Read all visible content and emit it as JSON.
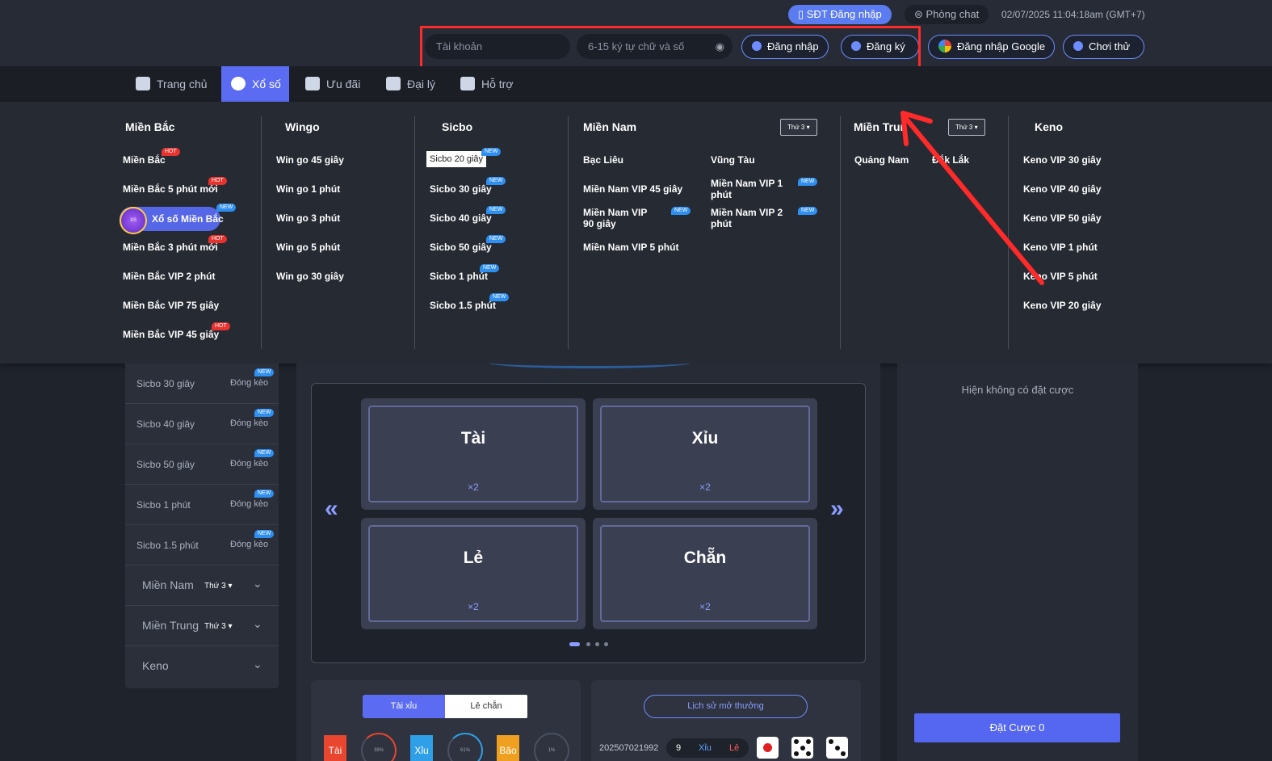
{
  "header": {
    "sdt_login": "SĐT Đăng nhập",
    "chat": "Phòng chat",
    "datetime": "02/07/2025 11:04:18am",
    "timezone": "(GMT+7)",
    "username_placeholder": "Tài khoản",
    "password_placeholder": "6-15 ký tự chữ và số",
    "login": "Đăng nhập",
    "register": "Đăng ký",
    "google_login": "Đăng nhập Google",
    "try": "Chơi thử"
  },
  "nav": [
    "Trang chủ",
    "Xổ số",
    "Ưu đãi",
    "Đại lý",
    "Hỗ trợ"
  ],
  "mega": {
    "mien_bac": {
      "title": "Miền Bắc",
      "items": [
        {
          "label": "Miền Bắc",
          "badge": "HOT"
        },
        {
          "label": "Miền Bắc 5 phút mới",
          "badge": "HOT"
        },
        {
          "label": "Xổ số Miền Bắc",
          "badge": "NEW"
        },
        {
          "label": "Miền Bắc 3 phút mới",
          "badge": "HOT"
        },
        {
          "label": "Miền Bắc VIP 2 phút",
          "badge": ""
        },
        {
          "label": "Miền Bắc VIP 75 giây",
          "badge": ""
        },
        {
          "label": "Miền Bắc VIP 45 giây",
          "badge": "HOT"
        }
      ]
    },
    "wingo": {
      "title": "Wingo",
      "items": [
        "Win go 45 giây",
        "Win go 1 phút",
        "Win go 3 phút",
        "Win go 5 phút",
        "Win go 30 giây"
      ]
    },
    "sicbo": {
      "title": "Sicbo",
      "items": [
        "Sicbo 20 giây",
        "Sicbo 30 giây",
        "Sicbo 40 giây",
        "Sicbo 50 giây",
        "Sicbo 1 phút",
        "Sicbo 1.5 phút"
      ],
      "badge": "NEW"
    },
    "mien_nam": {
      "title": "Miền Nam",
      "day": "Thứ 3",
      "items": [
        "Bạc Liêu",
        "Vũng Tàu",
        "Miền Nam VIP 45 giây",
        "Miền Nam VIP 1 phút",
        "Miền Nam VIP 90 giây",
        "Miền Nam VIP 2 phút",
        "Miền Nam VIP 5 phút"
      ],
      "badge": "NEW"
    },
    "mien_trung": {
      "title": "Miền Trun",
      "day": "Thứ 3",
      "items": [
        "Quảng Nam",
        "Đắk Lắk"
      ]
    },
    "keno": {
      "title": "Keno",
      "items": [
        "Keno VIP 30 giây",
        "Keno VIP 40 giây",
        "Keno VIP 50 giây",
        "Keno VIP 1 phút",
        "Keno VIP 5 phút",
        "Keno VIP 20 giây"
      ]
    }
  },
  "sidebar": {
    "rows": [
      {
        "name": "Sicbo 30 giây",
        "status": "Đóng kèo",
        "badge": "NEW"
      },
      {
        "name": "Sicbo 40 giây",
        "status": "Đóng kèo",
        "badge": "NEW"
      },
      {
        "name": "Sicbo 50 giây",
        "status": "Đóng kèo",
        "badge": "NEW"
      },
      {
        "name": "Sicbo 1 phút",
        "status": "Đóng kèo",
        "badge": "NEW"
      },
      {
        "name": "Sicbo 1.5 phút",
        "status": "Đóng kèo",
        "badge": "NEW"
      }
    ],
    "groups": [
      {
        "name": "Miền Nam",
        "tag": "Thứ 3"
      },
      {
        "name": "Miền Trung",
        "tag": "Thứ 3"
      },
      {
        "name": "Keno",
        "tag": ""
      }
    ]
  },
  "board": {
    "cards": [
      {
        "label": "Tài",
        "odds": "×2"
      },
      {
        "label": "Xỉu",
        "odds": "×2"
      },
      {
        "label": "Lẻ",
        "odds": "×2"
      },
      {
        "label": "Chẵn",
        "odds": "×2"
      }
    ]
  },
  "stats": {
    "tabs": [
      "Tài xỉu",
      "Lẻ chẵn"
    ],
    "items": [
      {
        "label": "Tài",
        "pct": "38%",
        "color": "#e8462e"
      },
      {
        "label": "Xỉu",
        "pct": "61%",
        "color": "#2fa0e8"
      },
      {
        "label": "Bão",
        "pct": "1%",
        "color": "#f0a020"
      }
    ]
  },
  "history": {
    "button": "Lịch sử mở thưởng",
    "id": "202507021992",
    "sum": "9",
    "tx": "Xỉu",
    "lc": "Lẻ"
  },
  "right": {
    "no_bet": "Hiện không có đặt cược",
    "bet_button": "Đặt Cược 0"
  }
}
